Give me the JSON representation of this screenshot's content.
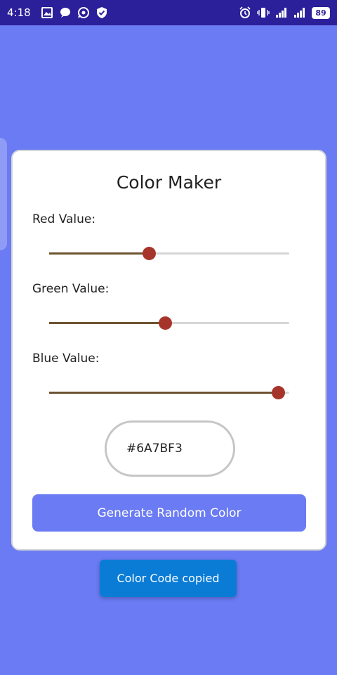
{
  "status_bar": {
    "time": "4:18",
    "battery": "89",
    "left_icons": [
      "gallery-icon",
      "chat-bubble-icon",
      "whatsapp-icon",
      "shield-check-icon"
    ],
    "right_icons": [
      "alarm-icon",
      "vibrate-icon",
      "signal-icon",
      "signal-icon"
    ]
  },
  "app": {
    "title": "Color Maker",
    "sliders": [
      {
        "label": "Red Value:",
        "value": 106,
        "max": 255
      },
      {
        "label": "Green Value:",
        "value": 123,
        "max": 255
      },
      {
        "label": "Blue Value:",
        "value": 243,
        "max": 255
      }
    ],
    "color_code": "#6A7BF3",
    "generate_button": "Generate Random Color"
  },
  "toast": {
    "message": "Color Code copied"
  },
  "colors": {
    "background": "#6A7BF3",
    "status_bar": "#2B1F9A",
    "slider_fill": "#6C5330",
    "slider_thumb": "#A7342A",
    "toast": "#0A7CD6"
  }
}
